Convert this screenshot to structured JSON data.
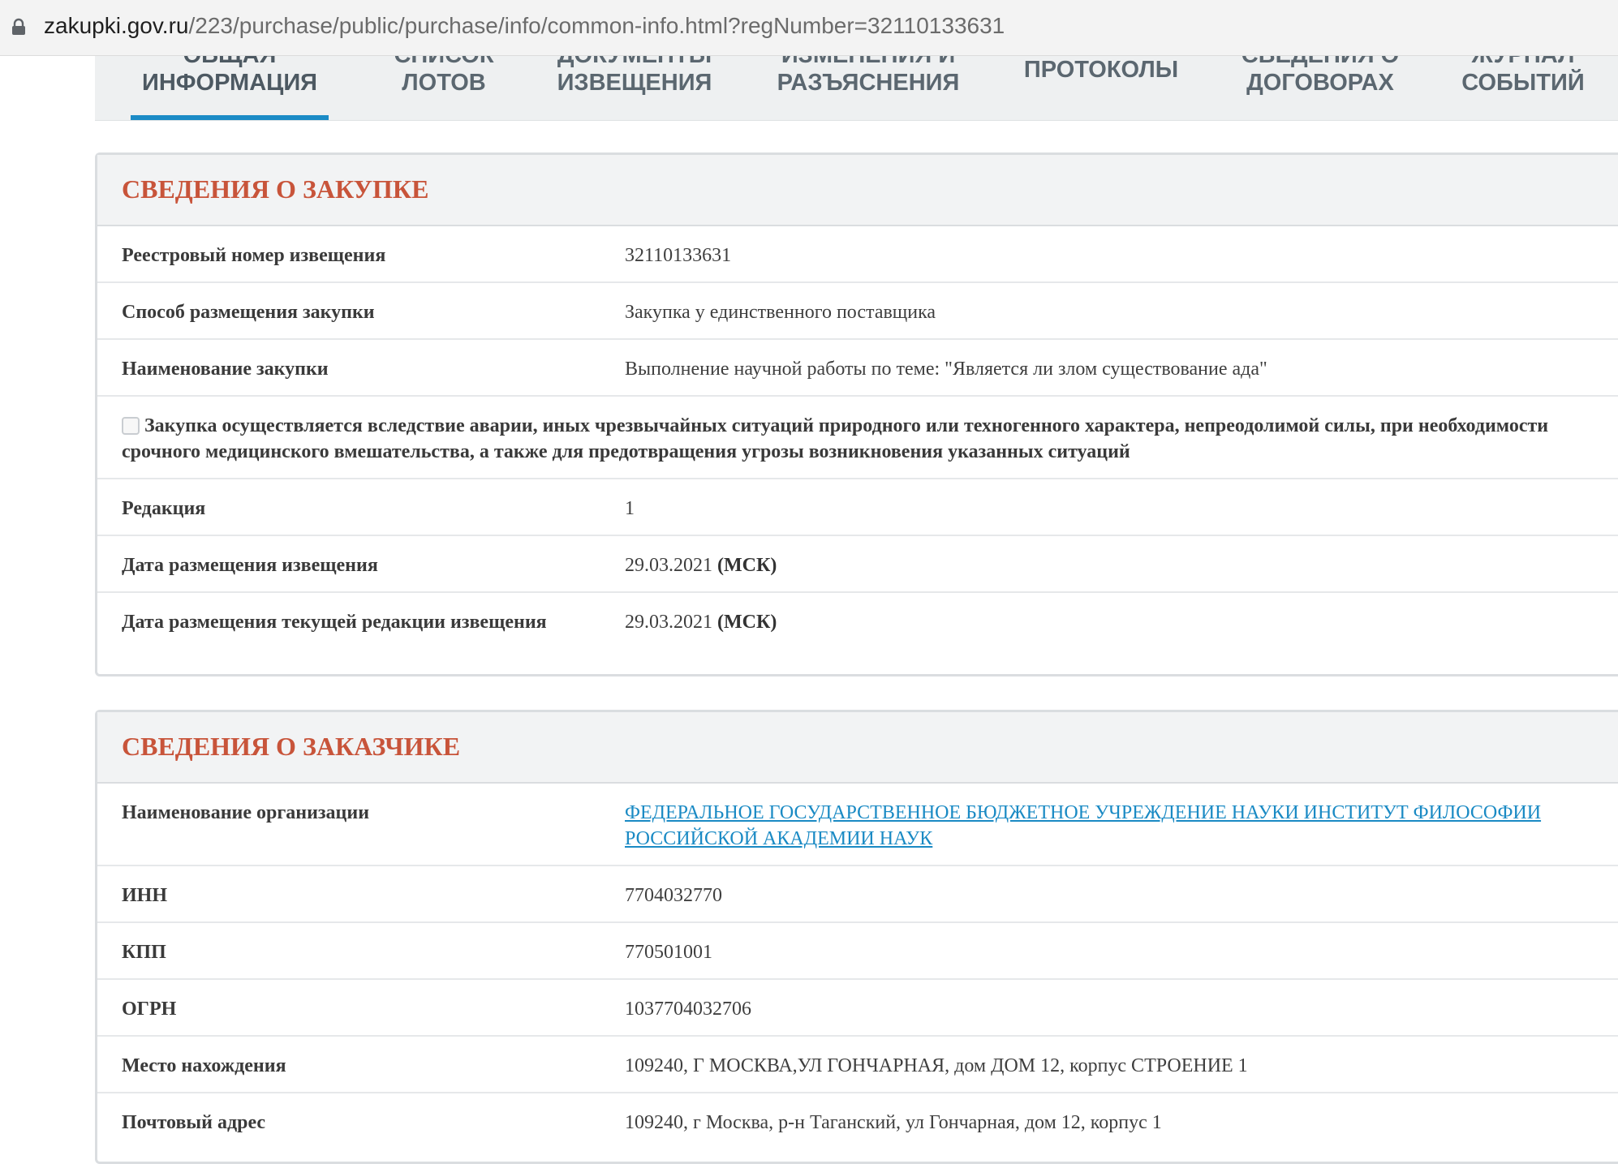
{
  "browser": {
    "url_host": "zakupki.gov.ru",
    "url_path": "/223/purchase/public/purchase/info/common-info.html?regNumber=32110133631",
    "lock_icon": "lock-icon"
  },
  "tabs": [
    {
      "line1": "ОБЩАЯ",
      "line2": "ИНФОРМАЦИЯ",
      "active": true
    },
    {
      "line1": "СПИСОК",
      "line2": "ЛОТОВ",
      "active": false
    },
    {
      "line1": "ДОКУМЕНТЫ",
      "line2": "ИЗВЕЩЕНИЯ",
      "active": false
    },
    {
      "line1": "ИЗМЕНЕНИЯ И",
      "line2": "РАЗЪЯСНЕНИЯ",
      "active": false
    },
    {
      "line1": "ПРОТОКОЛЫ",
      "line2": "",
      "active": false
    },
    {
      "line1": "СВЕДЕНИЯ О",
      "line2": "ДОГОВОРАХ",
      "active": false
    },
    {
      "line1": "ЖУРНАЛ",
      "line2": "СОБЫТИЙ",
      "active": false
    }
  ],
  "purchase": {
    "title": "СВЕДЕНИЯ О ЗАКУПКЕ",
    "reg_number_label": "Реестровый номер извещения",
    "reg_number": "32110133631",
    "method_label": "Способ размещения закупки",
    "method": "Закупка у единственного поставщика",
    "name_label": "Наименование закупки",
    "name": "Выполнение научной работы по теме: \"Является ли злом существование ада\"",
    "emergency_text": "Закупка осуществляется вследствие аварии, иных чрезвычайных ситуаций природного или техногенного характера, непреодолимой силы, при необходимости срочного медицинского вмешательства, а также для предотвращения угрозы возникновения указанных ситуаций",
    "emergency_checked": false,
    "edition_label": "Редакция",
    "edition": "1",
    "notice_date_label": "Дата размещения извещения",
    "notice_date": "29.03.2021",
    "notice_date_tz": "(МСК)",
    "current_date_label": "Дата размещения текущей редакции извещения",
    "current_date": "29.03.2021",
    "current_date_tz": "(МСК)"
  },
  "customer": {
    "title": "СВЕДЕНИЯ О ЗАКАЗЧИКЕ",
    "org_label": "Наименование организации",
    "org_name": "ФЕДЕРАЛЬНОЕ ГОСУДАРСТВЕННОЕ БЮДЖЕТНОЕ УЧРЕЖДЕНИЕ НАУКИ ИНСТИТУТ ФИЛОСОФИИ РОССИЙСКОЙ АКАДЕМИИ НАУК",
    "inn_label": "ИНН",
    "inn": "7704032770",
    "kpp_label": "КПП",
    "kpp": "770501001",
    "ogrn_label": "ОГРН",
    "ogrn": "1037704032706",
    "location_label": "Место нахождения",
    "location": "109240, Г МОСКВА,УЛ ГОНЧАРНАЯ, дом ДОМ 12, корпус СТРОЕНИЕ 1",
    "postal_label": "Почтовый адрес",
    "postal": "109240, г Москва, р-н Таганский, ул Гончарная, дом 12, корпус 1"
  },
  "colors": {
    "accent_title": "#c8543a",
    "link": "#1a8ac4",
    "tab_underline": "#1b8bc6"
  }
}
